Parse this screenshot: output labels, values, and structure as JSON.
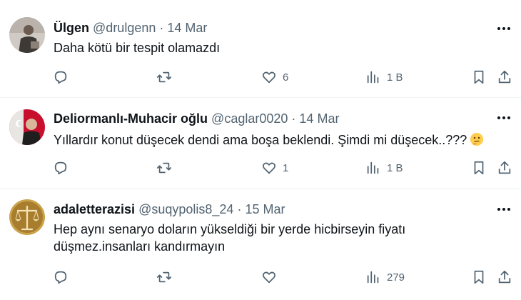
{
  "tweets": [
    {
      "name": "Ülgen",
      "handle": "@drulgenn",
      "separator": "·",
      "date": "14 Mar",
      "text": "Daha kötü bir tespit olamazdı",
      "emoji_icon": "",
      "stats": {
        "replies": "",
        "retweets": "",
        "likes": "6",
        "views": "1 B"
      },
      "avatar_icon": "person-photo-avatar"
    },
    {
      "name": "Deliormanlı-Muhacir oğlu",
      "handle": "@caglar0020",
      "separator": "·",
      "date": "14 Mar",
      "text": "Yıllardır konut düşecek dendi ama boşa beklendi. Şimdi mi düşecek..???",
      "emoji_icon": "thinking-face-emoji",
      "stats": {
        "replies": "",
        "retweets": "",
        "likes": "1",
        "views": "1 B"
      },
      "avatar_icon": "flag-portrait-avatar"
    },
    {
      "name": "adaletterazisi",
      "handle": "@suqypolis8_24",
      "separator": "·",
      "date": "15 Mar",
      "text": "Hep aynı senaryo doların yükseldiği bir yerde hicbirseyin fiyatı düşmez.insanları kandırmayın",
      "emoji_icon": "",
      "stats": {
        "replies": "",
        "retweets": "",
        "likes": "",
        "views": "279"
      },
      "avatar_icon": "scales-of-justice-avatar"
    }
  ],
  "icons": {
    "reply": "reply-icon",
    "retweet": "retweet-icon",
    "like": "heart-icon",
    "views": "views-chart-icon",
    "bookmark": "bookmark-icon",
    "share": "share-icon",
    "more": "more-dots-icon"
  },
  "colors": {
    "text": "#0f1419",
    "secondary": "#536471",
    "divider": "#eff3f4"
  }
}
